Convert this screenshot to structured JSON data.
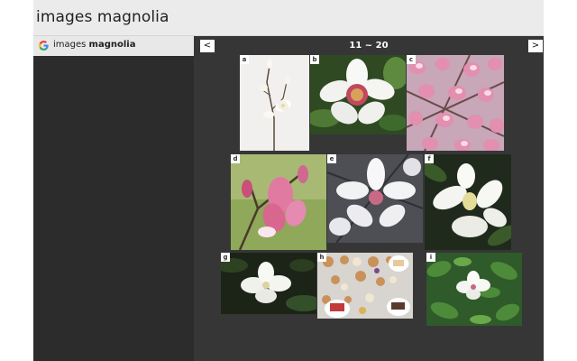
{
  "window": {
    "title": "images magnolia"
  },
  "sidebar": {
    "suggestion": {
      "icon": "google-g-icon",
      "query_prefix": "images ",
      "query_bold": "magnolia"
    }
  },
  "results": {
    "prev_label": "<",
    "next_label": ">",
    "page_range": "11 ~ 20",
    "images": [
      {
        "tag": "a",
        "subject": "magnolia-branch-white-background"
      },
      {
        "tag": "b",
        "subject": "white-magnolia-flower-closeup"
      },
      {
        "tag": "c",
        "subject": "pink-magnolia-tree-blossoms"
      },
      {
        "tag": "d",
        "subject": "pink-magnolia-buds"
      },
      {
        "tag": "e",
        "subject": "white-magnolia-pink-center"
      },
      {
        "tag": "f",
        "subject": "white-southern-magnolia"
      },
      {
        "tag": "g",
        "subject": "white-magnolia-dark-leaves"
      },
      {
        "tag": "h",
        "subject": "pastries-on-table"
      },
      {
        "tag": "i",
        "subject": "white-magnolia-on-tree"
      }
    ]
  },
  "colors": {
    "content_bg": "#363636",
    "sidebar_bg": "#2c2c2c",
    "titlebar_bg": "#ebebeb"
  }
}
